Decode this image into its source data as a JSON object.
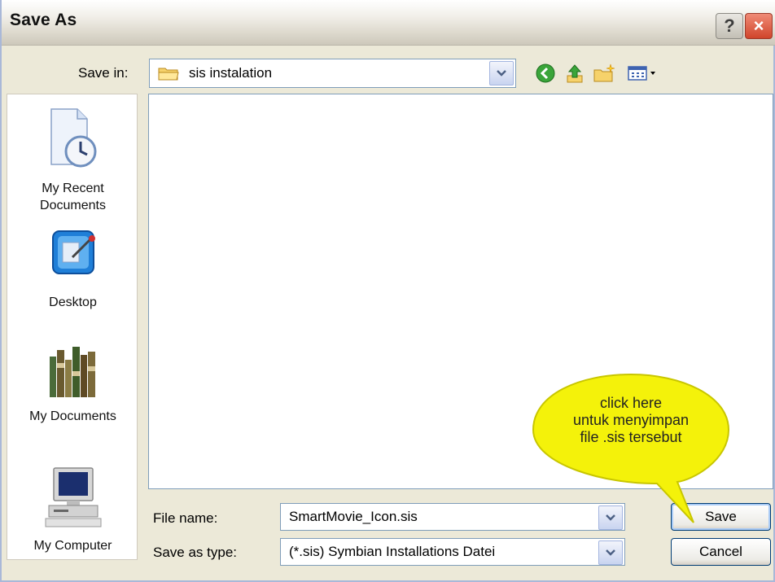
{
  "window": {
    "title": "Save As"
  },
  "title_buttons": {
    "help": "?",
    "close": "×"
  },
  "save_in": {
    "label": "Save in:",
    "value": "sis instalation"
  },
  "places": [
    {
      "label_line1": "My Recent",
      "label_line2": "Documents"
    },
    {
      "label_line1": "Desktop"
    },
    {
      "label_line1": "My Documents"
    },
    {
      "label_line1": "My Computer"
    }
  ],
  "file_name": {
    "label": "File name:",
    "value": "SmartMovie_Icon.sis"
  },
  "save_type": {
    "label": "Save as type:",
    "value": "(*.sis) Symbian Installations Datei"
  },
  "buttons": {
    "save": "Save",
    "cancel": "Cancel"
  },
  "callout": {
    "line1": "click here",
    "line2": "untuk menyimpan",
    "line3": "file .sis tersebut",
    "color": "#f4f20a"
  }
}
